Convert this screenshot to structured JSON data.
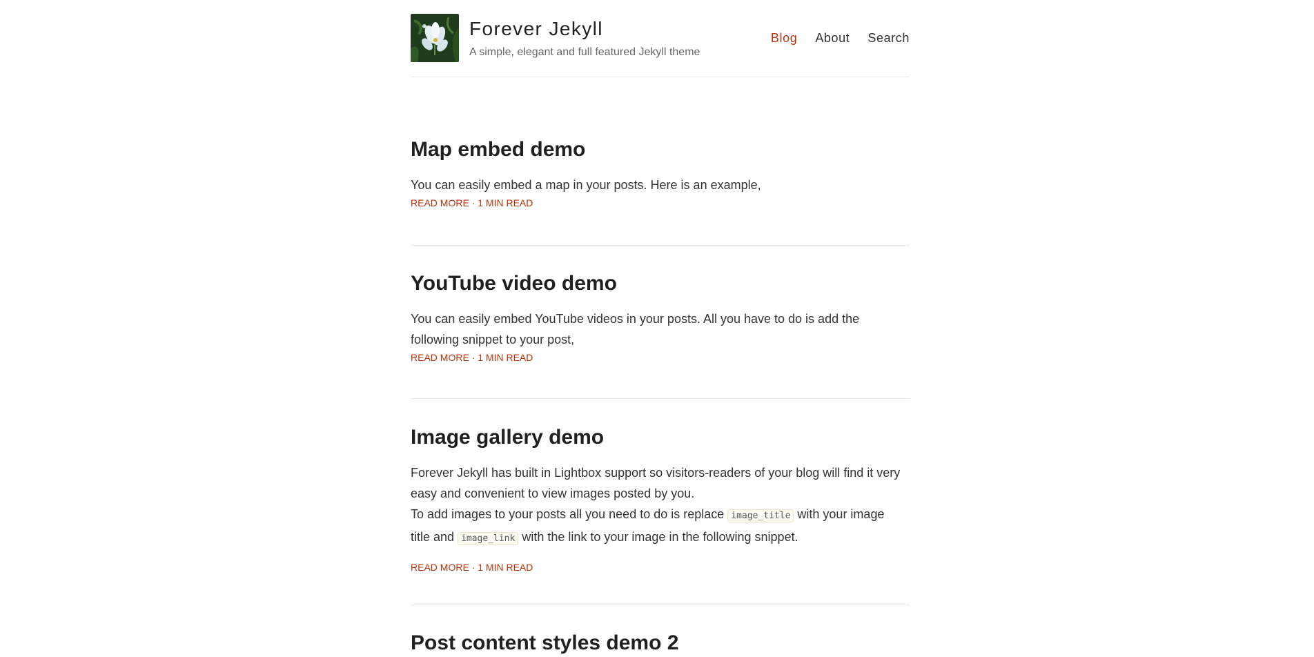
{
  "site": {
    "title": "Forever Jekyll",
    "description": "A simple, elegant and full featured Jekyll theme"
  },
  "nav": [
    {
      "label": "Blog",
      "active": true
    },
    {
      "label": "About",
      "active": false
    },
    {
      "label": "Search",
      "active": false
    }
  ],
  "posts": [
    {
      "title": "Map embed demo",
      "excerpt": "You can easily embed a map in your posts. Here is an example,",
      "read_more": "READ MORE",
      "separator": "·",
      "read_time": "1 MIN READ"
    },
    {
      "title": "YouTube video demo",
      "excerpt_line1": "You can easily embed YouTube videos in your posts. All you have to do is add the",
      "excerpt_line2": "following snippet to your post,",
      "read_more": "READ MORE",
      "separator": "·",
      "read_time": "1 MIN READ"
    },
    {
      "title": "Image gallery demo",
      "excerpt_line1": "Forever Jekyll has built in Lightbox support so visitors-readers of your blog will find it very",
      "excerpt_line2": "easy and convenient to view images posted by you.",
      "excerpt_line3_a": "To add images to your posts all you need to do is replace",
      "code1": "image_title",
      "excerpt_line3_b": "with your image",
      "excerpt_line4_a": "title and",
      "code2": "image_link",
      "excerpt_line4_b": "with the link to your image in the following snippet.",
      "read_more": "READ MORE",
      "separator": "·",
      "read_time": "1 MIN READ"
    },
    {
      "title": "Post content styles demo 2"
    }
  ]
}
